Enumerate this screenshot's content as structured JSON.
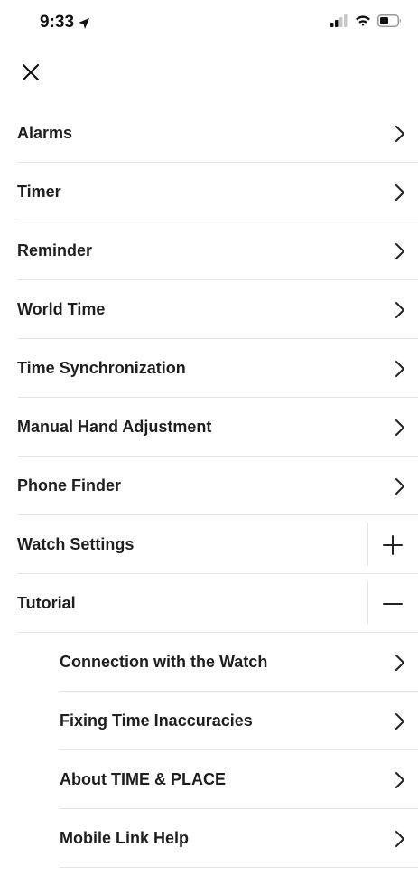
{
  "status_bar": {
    "time": "9:33",
    "icons": [
      "location-arrow-icon",
      "signal-icon",
      "wifi-icon",
      "battery-icon"
    ]
  },
  "header": {
    "close_icon": "close-icon"
  },
  "menu": {
    "items": [
      {
        "label": "Alarms",
        "icon": "chevron-right-icon"
      },
      {
        "label": "Timer",
        "icon": "chevron-right-icon"
      },
      {
        "label": "Reminder",
        "icon": "chevron-right-icon"
      },
      {
        "label": "World Time",
        "icon": "chevron-right-icon"
      },
      {
        "label": "Time Synchronization",
        "icon": "chevron-right-icon"
      },
      {
        "label": "Manual Hand Adjustment",
        "icon": "chevron-right-icon"
      },
      {
        "label": "Phone Finder",
        "icon": "chevron-right-icon"
      },
      {
        "label": "Watch Settings",
        "icon": "plus-icon"
      },
      {
        "label": "Tutorial",
        "icon": "minus-icon"
      }
    ],
    "tutorial_items": [
      {
        "label": "Connection with the Watch",
        "icon": "chevron-right-icon"
      },
      {
        "label": "Fixing Time Inaccuracies",
        "icon": "chevron-right-icon"
      },
      {
        "label": "About TIME & PLACE",
        "icon": "chevron-right-icon"
      },
      {
        "label": "Mobile Link Help",
        "icon": "chevron-right-icon"
      }
    ]
  }
}
